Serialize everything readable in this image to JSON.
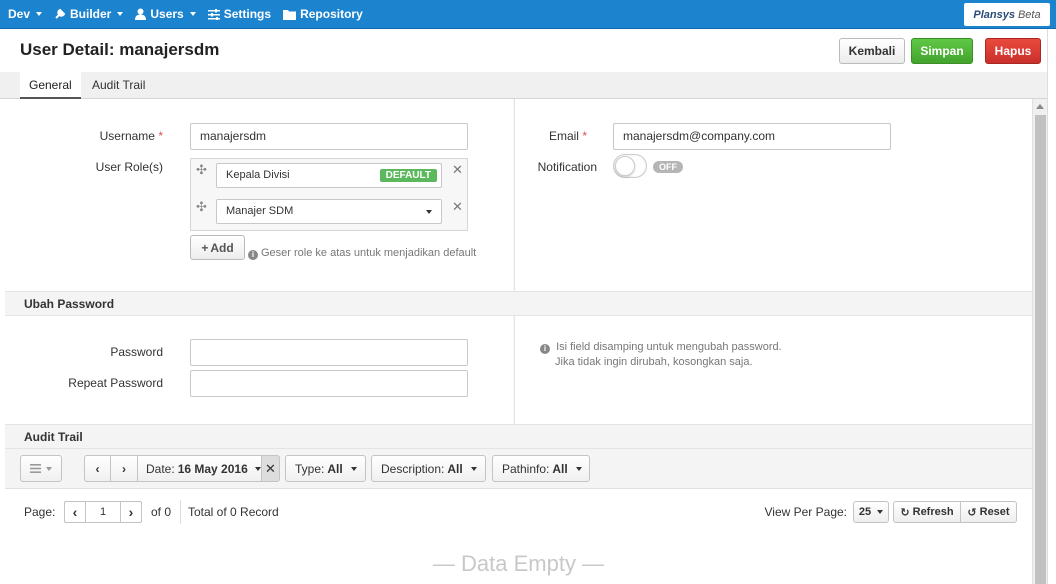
{
  "nav": {
    "items": [
      {
        "label": "Dev",
        "icon": "none",
        "caret": true
      },
      {
        "label": "Builder",
        "icon": "wrench-icon",
        "caret": true
      },
      {
        "label": "Users",
        "icon": "user-icon",
        "caret": true
      },
      {
        "label": "Settings",
        "icon": "sliders-icon",
        "caret": false
      },
      {
        "label": "Repository",
        "icon": "folder-icon",
        "caret": false
      }
    ],
    "brand": "Plansys",
    "brand_suffix": "Beta",
    "accent": "#1c83cf"
  },
  "header": {
    "title": "User Detail: manajersdm",
    "back_label": "Kembali",
    "save_label": "Simpan",
    "delete_label": "Hapus"
  },
  "tabs": [
    {
      "label": "General",
      "active": true
    },
    {
      "label": "Audit Trail",
      "active": false
    }
  ],
  "general": {
    "username_label": "Username",
    "username_value": "manajersdm",
    "roles_label": "User Role(s)",
    "roles": [
      {
        "name": "Kepala Divisi",
        "badge": "DEFAULT"
      },
      {
        "name": "Manajer SDM",
        "badge": ""
      }
    ],
    "add_label": "Add",
    "roles_hint": "Geser role ke atas untuk menjadikan default",
    "email_label": "Email",
    "email_value": "manajersdm@company.com",
    "notification_label": "Notification",
    "notification_state": "OFF"
  },
  "password": {
    "section_title": "Ubah Password",
    "password_label": "Password",
    "repeat_label": "Repeat Password",
    "hint_line1": "Isi field disamping untuk mengubah password.",
    "hint_line2": "Jika tidak ingin dirubah, kosongkan saja."
  },
  "audit": {
    "section_title": "Audit Trail",
    "date_label": "Date:",
    "date_value": "16 May 2016",
    "type_label": "Type:",
    "type_value": "All",
    "description_label": "Description:",
    "description_value": "All",
    "pathinfo_label": "Pathinfo:",
    "pathinfo_value": "All",
    "page_label": "Page:",
    "page_value": "1",
    "of_label": "of 0",
    "total_label": "Total of 0 Record",
    "view_per_page_label": "View Per Page:",
    "per_page_value": "25",
    "refresh_label": "Refresh",
    "reset_label": "Reset",
    "empty_text": "— Data Empty —"
  }
}
